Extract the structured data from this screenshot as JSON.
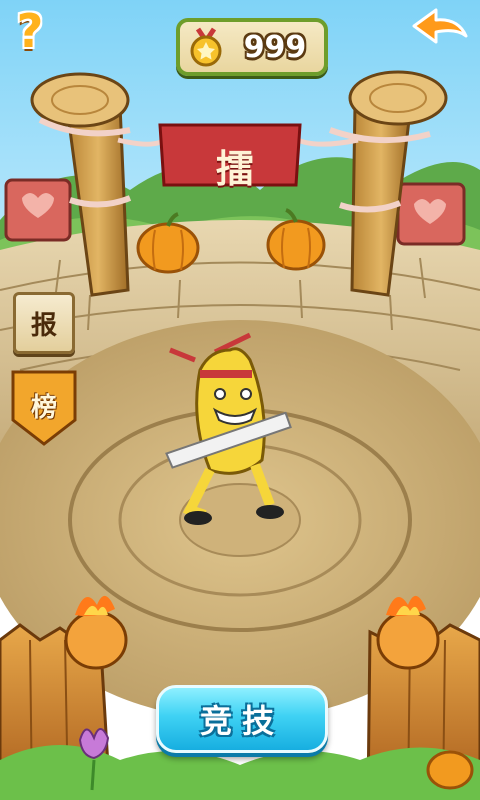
{
  "hud": {
    "help_label": "?",
    "coins": "999",
    "back_icon": "back-arrow-icon"
  },
  "banner": {
    "text": "擂"
  },
  "side_buttons": {
    "signup_label": "报",
    "rank_label": "榜"
  },
  "main_button": {
    "label": "竞技"
  },
  "colors": {
    "accent_green": "#6e9d2b",
    "button_blue": "#17aee0",
    "banner_red": "#c8383a",
    "help_orange": "#ffb21c",
    "back_orange": "#ff9a1a"
  }
}
